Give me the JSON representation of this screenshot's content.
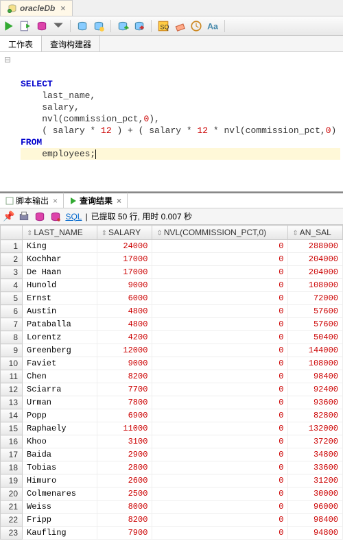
{
  "connection_tab": {
    "name": "oracleDb"
  },
  "inner_tabs": {
    "worksheet": "工作表",
    "query_builder": "查询构建器"
  },
  "sql": {
    "kw_select": "SELECT",
    "line2": "    last_name,",
    "line3": "    salary,",
    "line4a": "    nvl(commission_pct,",
    "line4b": "),",
    "line5a": "    ( salary * ",
    "line5b": " ) + ( salary * ",
    "line5c": " * nvl(commission_pct,",
    "line5d": ") ) an_",
    "kw_from": "FROM",
    "line7": "    employees;",
    "n0": "0",
    "n12": "12"
  },
  "output_tabs": {
    "script_out": "脚本输出",
    "query_result": "查询结果"
  },
  "status": {
    "sql": "SQL",
    "sep": "|",
    "fetched": "已提取 50 行, 用时 0.007 秒"
  },
  "columns": [
    "LAST_NAME",
    "SALARY",
    "NVL(COMMISSION_PCT,0)",
    "AN_SAL"
  ],
  "rows": [
    {
      "n": 1,
      "name": "King",
      "sal": 24000,
      "nvl": 0,
      "an": 288000
    },
    {
      "n": 2,
      "name": "Kochhar",
      "sal": 17000,
      "nvl": 0,
      "an": 204000
    },
    {
      "n": 3,
      "name": "De Haan",
      "sal": 17000,
      "nvl": 0,
      "an": 204000
    },
    {
      "n": 4,
      "name": "Hunold",
      "sal": 9000,
      "nvl": 0,
      "an": 108000
    },
    {
      "n": 5,
      "name": "Ernst",
      "sal": 6000,
      "nvl": 0,
      "an": 72000
    },
    {
      "n": 6,
      "name": "Austin",
      "sal": 4800,
      "nvl": 0,
      "an": 57600
    },
    {
      "n": 7,
      "name": "Pataballa",
      "sal": 4800,
      "nvl": 0,
      "an": 57600
    },
    {
      "n": 8,
      "name": "Lorentz",
      "sal": 4200,
      "nvl": 0,
      "an": 50400
    },
    {
      "n": 9,
      "name": "Greenberg",
      "sal": 12000,
      "nvl": 0,
      "an": 144000
    },
    {
      "n": 10,
      "name": "Faviet",
      "sal": 9000,
      "nvl": 0,
      "an": 108000
    },
    {
      "n": 11,
      "name": "Chen",
      "sal": 8200,
      "nvl": 0,
      "an": 98400
    },
    {
      "n": 12,
      "name": "Sciarra",
      "sal": 7700,
      "nvl": 0,
      "an": 92400
    },
    {
      "n": 13,
      "name": "Urman",
      "sal": 7800,
      "nvl": 0,
      "an": 93600
    },
    {
      "n": 14,
      "name": "Popp",
      "sal": 6900,
      "nvl": 0,
      "an": 82800
    },
    {
      "n": 15,
      "name": "Raphaely",
      "sal": 11000,
      "nvl": 0,
      "an": 132000
    },
    {
      "n": 16,
      "name": "Khoo",
      "sal": 3100,
      "nvl": 0,
      "an": 37200
    },
    {
      "n": 17,
      "name": "Baida",
      "sal": 2900,
      "nvl": 0,
      "an": 34800
    },
    {
      "n": 18,
      "name": "Tobias",
      "sal": 2800,
      "nvl": 0,
      "an": 33600
    },
    {
      "n": 19,
      "name": "Himuro",
      "sal": 2600,
      "nvl": 0,
      "an": 31200
    },
    {
      "n": 20,
      "name": "Colmenares",
      "sal": 2500,
      "nvl": 0,
      "an": 30000
    },
    {
      "n": 21,
      "name": "Weiss",
      "sal": 8000,
      "nvl": 0,
      "an": 96000
    },
    {
      "n": 22,
      "name": "Fripp",
      "sal": 8200,
      "nvl": 0,
      "an": 98400
    },
    {
      "n": 23,
      "name": "Kaufling",
      "sal": 7900,
      "nvl": 0,
      "an": 94800
    }
  ]
}
